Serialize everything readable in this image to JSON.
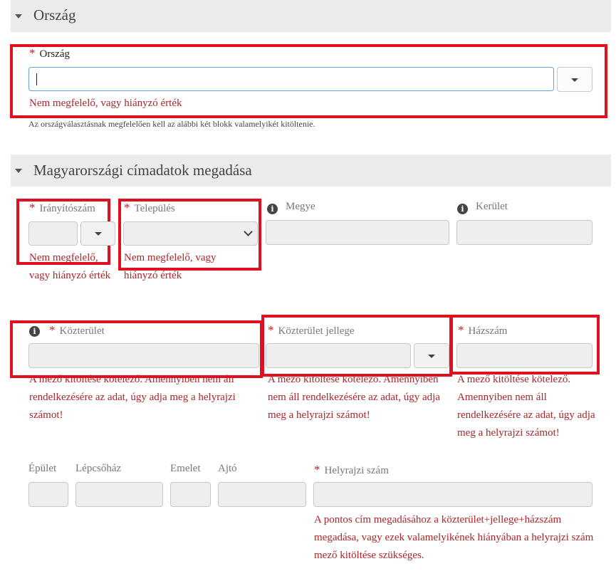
{
  "country_section": {
    "title": "Ország",
    "field_label": "Ország",
    "required_mark": "*",
    "value": "",
    "error": "Nem megfelelő, vagy hiányzó érték",
    "note": "Az országválasztásnak megfelelően kell az alábbi két blokk valamelyikét kitöltenie."
  },
  "address_section": {
    "title": "Magyarországi címadatok megadása",
    "postal_code": {
      "label": "Irányítószám",
      "required_mark": "*",
      "error": "Nem megfelelő, vagy hiányzó érték"
    },
    "settlement": {
      "label": "Település",
      "required_mark": "*",
      "error": "Nem megfelelő, vagy hiányzó érték"
    },
    "county": {
      "label": "Megye",
      "info_icon": "i"
    },
    "district": {
      "label": "Kerület",
      "info_icon": "i"
    },
    "public_place": {
      "label": "Közterület",
      "required_mark": "*",
      "info_icon": "i",
      "error": "A mező kitöltése kötelező. Amennyiben nem áll rendelkezésére az adat, úgy adja meg a helyrajzi számot!"
    },
    "public_place_type": {
      "label": "Közterület jellege",
      "required_mark": "*",
      "error": "A mező kitöltése kötelező. Amennyiben nem áll rendelkezésére az adat, úgy adja meg a helyrajzi számot!"
    },
    "house_number": {
      "label": "Házszám",
      "required_mark": "*",
      "error": "A mező kitöltése kötelező. Amennyiben nem áll rendelkezésére az adat, úgy adja meg a helyrajzi számot!"
    },
    "building": {
      "label": "Épület"
    },
    "staircase": {
      "label": "Lépcsőház"
    },
    "floor": {
      "label": "Emelet"
    },
    "door": {
      "label": "Ajtó"
    },
    "lot_number": {
      "label": "Helyrajzi szám",
      "required_mark": "*",
      "error": "A pontos cím megadásához a közterület+jellege+házszám megadása, vagy ezek valamelyikének hiányában a helyrajzi szám mező kitöltése szükséges."
    }
  },
  "colors": {
    "error_box": "#e01020",
    "required": "#c8171e",
    "error_text": "#a8262a",
    "section_bg": "#ebebeb"
  },
  "icons": [
    "collapse-caret-icon",
    "info-icon",
    "chevron-down-icon"
  ]
}
